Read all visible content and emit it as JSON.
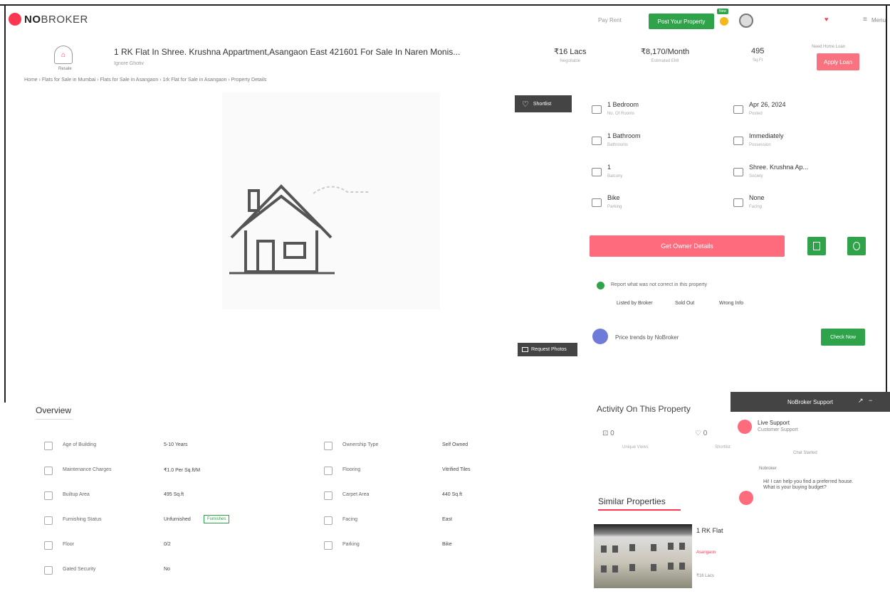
{
  "header": {
    "logo_bold": "NO",
    "logo_rest": "BROKER",
    "pay_rent": "Pay Rent",
    "post_property": "Post Your Property",
    "new_badge": "New",
    "username": "Menu",
    "menu": "≡"
  },
  "property": {
    "icon_label": "Resale",
    "title": "1 RK Flat In Shree. Krushna Appartment,Asangaon East 421601 For Sale In Naren Monis...",
    "subtitle": "Ignore Ghotiv",
    "breadcrumb": "Home › Flats for Sale in Mumbai › Flats for Sale in Asangaon › 1rk Flat for Sale in Asangaon › Property Details"
  },
  "stats": [
    {
      "value": "₹16 Lacs",
      "label": "Negotiable"
    },
    {
      "value": "₹8,170/Month",
      "label": "Estimated EMI"
    },
    {
      "value": "495",
      "label": "Sq.Ft"
    }
  ],
  "loan": {
    "caption": "Need Home Loan",
    "button": "Apply Loan"
  },
  "gallery": {
    "shortlist": "Shortlist",
    "request_photos": "Request Photos"
  },
  "details": [
    {
      "value": "1 Bedroom",
      "label": "No. Of Rooms"
    },
    {
      "value": "Apr 26, 2024",
      "label": "Posted"
    },
    {
      "value": "1 Bathroom",
      "label": "Bathrooms"
    },
    {
      "value": "Immediately",
      "label": "Possession"
    },
    {
      "value": "1",
      "label": "Balcony"
    },
    {
      "value": "Shree. Krushna Ap...",
      "label": "Society"
    },
    {
      "value": "Bike",
      "label": "Parking"
    },
    {
      "value": "None",
      "label": "Facing"
    }
  ],
  "actions": {
    "owner_details": "Get Owner Details"
  },
  "report": {
    "text": "Report what was not correct in this property",
    "options": [
      "Listed by Broker",
      "Sold Out",
      "Wrong Info"
    ]
  },
  "trends": {
    "text": "Price trends by NoBroker",
    "button": "Check Now"
  },
  "overview": {
    "title": "Overview",
    "rows": [
      {
        "label": "Age of Building",
        "value": "5-10 Years"
      },
      {
        "label": "Ownership Type",
        "value": "Self Owned"
      },
      {
        "label": "Maintenance Charges",
        "value": "₹1.0 Per Sq.ft/M"
      },
      {
        "label": "Flooring",
        "value": "Vitrified Tiles"
      },
      {
        "label": "Builtup Area",
        "value": "495 Sq.ft"
      },
      {
        "label": "Carpet Area",
        "value": "440 Sq.ft"
      },
      {
        "label": "Furnishing Status",
        "value": "Unfurnished"
      },
      {
        "label": "Facing",
        "value": "East"
      },
      {
        "label": "Floor",
        "value": "0/2"
      },
      {
        "label": "Parking",
        "value": "Bike"
      },
      {
        "label": "Gated Security",
        "value": "No"
      }
    ],
    "furnish_tag": "Furnishes"
  },
  "activity": {
    "title": "Activity On This Property",
    "views": "0",
    "views_label": "Unique Views",
    "shortlists": "0",
    "shortlists_label": "Shortlists"
  },
  "similar": {
    "title": "Similar Properties",
    "name": "1 RK Flat",
    "tag": "Asangaon",
    "price": "₹16 Lacs"
  },
  "support": {
    "title": "NoBroker Support",
    "agent": "Live Support",
    "agent_sub": "Customer Support",
    "started": "Chat Started",
    "bot": "Nobroker",
    "message": "Hi! I can help you find a preferred house. What is your buying budget?"
  }
}
